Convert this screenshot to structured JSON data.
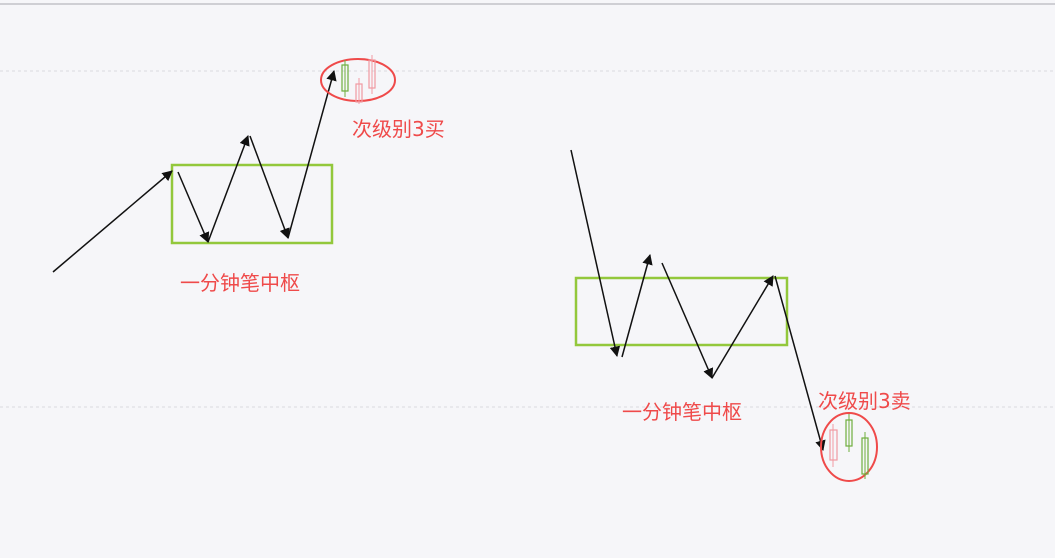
{
  "colors": {
    "background": "#f6f6f9",
    "top_border": "#cfcfd4",
    "grid": "#d9d9de",
    "arrow": "#111111",
    "zone_box": "#93c83c",
    "label": "#ef4a4a",
    "marker_circle": "#ef4a4a",
    "candle_green": "#6fae3c",
    "candle_pink": "#f19aa2"
  },
  "left_panel": {
    "zone_label": "一分钟笔中枢",
    "signal_label": "次级别3买"
  },
  "right_panel": {
    "zone_label": "一分钟笔中枢",
    "signal_label": "次级别3卖"
  }
}
